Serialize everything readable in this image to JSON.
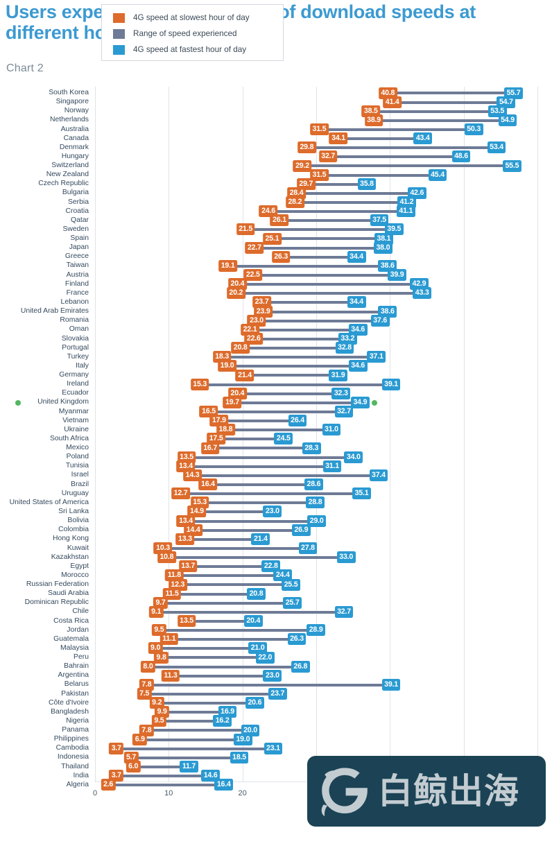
{
  "header": {
    "title": "Users experience a wide range of download speeds at different hours",
    "subtitle": "Chart 2",
    "title_color": "#3c9ad1"
  },
  "legend": {
    "items": [
      {
        "label": "4G speed at slowest hour of day",
        "color": "#dd6b2b",
        "icon": "square-swatch-icon"
      },
      {
        "label": "Range of speed experienced",
        "color": "#6e7b96",
        "icon": "square-swatch-icon"
      },
      {
        "label": "4G speed at fastest hour of day",
        "color": "#2a9ad2",
        "icon": "square-swatch-icon"
      }
    ]
  },
  "watermark": {
    "text": "白鲸出海",
    "background": "#1b4355",
    "foreground": "#c3ccd1"
  },
  "highlight": {
    "country": "United Kingdom",
    "dot_color": "#53b761"
  },
  "chart_data": {
    "type": "bar",
    "title": "Users experience a wide range of download speeds at different hours",
    "subtitle": "Chart 2",
    "xlabel": "",
    "ylabel": "",
    "xlim": [
      0,
      60
    ],
    "xticks": [
      0,
      10,
      20,
      30,
      40,
      50,
      60
    ],
    "grid": true,
    "legend_position": "top-left",
    "orientation": "horizontal",
    "series": [
      {
        "name": "4G speed at slowest hour of day",
        "color": "#dd6b2b"
      },
      {
        "name": "Range of speed experienced",
        "color": "#6e7b96"
      },
      {
        "name": "4G speed at fastest hour of day",
        "color": "#2a9ad2"
      }
    ],
    "categories": [
      "South Korea",
      "Singapore",
      "Norway",
      "Netherlands",
      "Australia",
      "Canada",
      "Denmark",
      "Hungary",
      "Switzerland",
      "New Zealand",
      "Czech Republic",
      "Bulgaria",
      "Serbia",
      "Croatia",
      "Qatar",
      "Sweden",
      "Spain",
      "Japan",
      "Greece",
      "Taiwan",
      "Austria",
      "Finland",
      "France",
      "Lebanon",
      "United Arab Emirates",
      "Romania",
      "Oman",
      "Slovakia",
      "Portugal",
      "Turkey",
      "Italy",
      "Germany",
      "Ireland",
      "Ecuador",
      "United Kingdom",
      "Myanmar",
      "Vietnam",
      "Ukraine",
      "South Africa",
      "Mexico",
      "Poland",
      "Tunisia",
      "Israel",
      "Brazil",
      "Uruguay",
      "United States of America",
      "Sri Lanka",
      "Bolivia",
      "Colombia",
      "Hong Kong",
      "Kuwait",
      "Kazakhstan",
      "Egypt",
      "Morocco",
      "Russian Federation",
      "Saudi Arabia",
      "Dominican Republic",
      "Chile",
      "Costa Rica",
      "Jordan",
      "Guatemala",
      "Malaysia",
      "Peru",
      "Bahrain",
      "Argentina",
      "Belarus",
      "Pakistan",
      "Côte d'Ivoire",
      "Bangladesh",
      "Nigeria",
      "Panama",
      "Philippines",
      "Cambodia",
      "Indonesia",
      "Thailand",
      "India",
      "Algeria"
    ],
    "slowest": [
      40.8,
      41.4,
      38.5,
      38.9,
      31.5,
      34.1,
      29.8,
      32.7,
      29.2,
      31.5,
      29.7,
      28.4,
      28.2,
      24.6,
      26.1,
      21.5,
      25.1,
      22.7,
      26.3,
      19.1,
      22.5,
      20.4,
      20.2,
      23.7,
      23.9,
      23.0,
      22.1,
      22.6,
      20.8,
      18.3,
      19.0,
      21.4,
      15.3,
      20.4,
      19.7,
      16.5,
      17.9,
      18.8,
      17.5,
      16.7,
      13.5,
      13.4,
      14.3,
      16.4,
      12.7,
      15.3,
      14.9,
      13.4,
      14.4,
      13.3,
      10.3,
      10.8,
      13.7,
      11.8,
      12.3,
      11.5,
      9.7,
      9.1,
      13.5,
      9.5,
      11.1,
      9.0,
      9.8,
      8.0,
      11.3,
      7.8,
      7.5,
      9.2,
      9.9,
      9.5,
      7.8,
      6.9,
      3.7,
      5.7,
      6.0,
      3.7,
      2.6
    ],
    "fastest": [
      55.7,
      54.7,
      53.5,
      54.9,
      50.3,
      43.4,
      53.4,
      48.6,
      55.5,
      45.4,
      35.8,
      42.6,
      41.2,
      41.1,
      37.5,
      39.5,
      38.1,
      38.0,
      34.4,
      38.6,
      39.9,
      42.9,
      43.3,
      34.4,
      38.6,
      37.6,
      34.6,
      33.2,
      32.8,
      37.1,
      34.6,
      31.9,
      39.1,
      32.3,
      34.9,
      32.7,
      26.4,
      31.0,
      24.5,
      28.3,
      34.0,
      31.1,
      37.4,
      28.6,
      35.1,
      28.8,
      23.0,
      29.0,
      26.9,
      21.4,
      27.8,
      33.0,
      22.8,
      24.4,
      25.5,
      20.8,
      25.7,
      32.7,
      20.4,
      28.9,
      26.3,
      21.0,
      22.0,
      26.8,
      23.0,
      39.1,
      23.7,
      20.6,
      16.9,
      16.2,
      20.0,
      19.0,
      23.1,
      18.5,
      11.7,
      14.6,
      16.4
    ]
  }
}
